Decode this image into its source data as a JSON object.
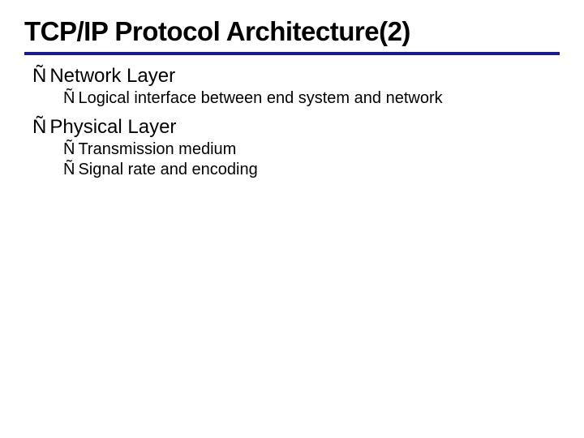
{
  "title": "TCP/IP Protocol Architecture(2)",
  "bullet_glyph": "Ñ",
  "sections": [
    {
      "heading": "Network Layer",
      "items": [
        "Logical interface between end system and network"
      ]
    },
    {
      "heading": "Physical Layer",
      "items": [
        "Transmission medium",
        "Signal rate and encoding"
      ]
    }
  ]
}
